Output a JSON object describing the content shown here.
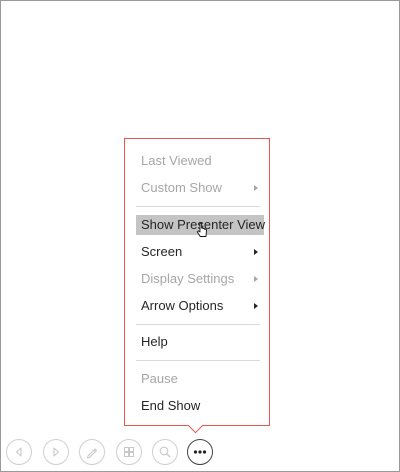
{
  "menu": {
    "items": [
      {
        "label": "Last Viewed",
        "disabled": true,
        "submenu": false
      },
      {
        "label": "Custom Show",
        "disabled": true,
        "submenu": true
      },
      {
        "label": "Show Presenter View",
        "disabled": false,
        "submenu": false,
        "highlighted": true
      },
      {
        "label": "Screen",
        "disabled": false,
        "submenu": true
      },
      {
        "label": "Display Settings",
        "disabled": true,
        "submenu": true
      },
      {
        "label": "Arrow Options",
        "disabled": false,
        "submenu": true
      },
      {
        "label": "Help",
        "disabled": false,
        "submenu": false
      },
      {
        "label": "Pause",
        "disabled": true,
        "submenu": false
      },
      {
        "label": "End Show",
        "disabled": false,
        "submenu": false
      }
    ]
  },
  "toolbar": {
    "buttons": [
      {
        "icon": "previous-arrow-icon"
      },
      {
        "icon": "next-arrow-icon"
      },
      {
        "icon": "pen-icon"
      },
      {
        "icon": "see-all-slides-icon"
      },
      {
        "icon": "zoom-icon"
      },
      {
        "icon": "more-options-icon"
      }
    ]
  },
  "colors": {
    "menu_border": "#e0584f",
    "highlight": "#c4c4c4",
    "disabled_text": "#a6a6a6",
    "text": "#262626"
  }
}
